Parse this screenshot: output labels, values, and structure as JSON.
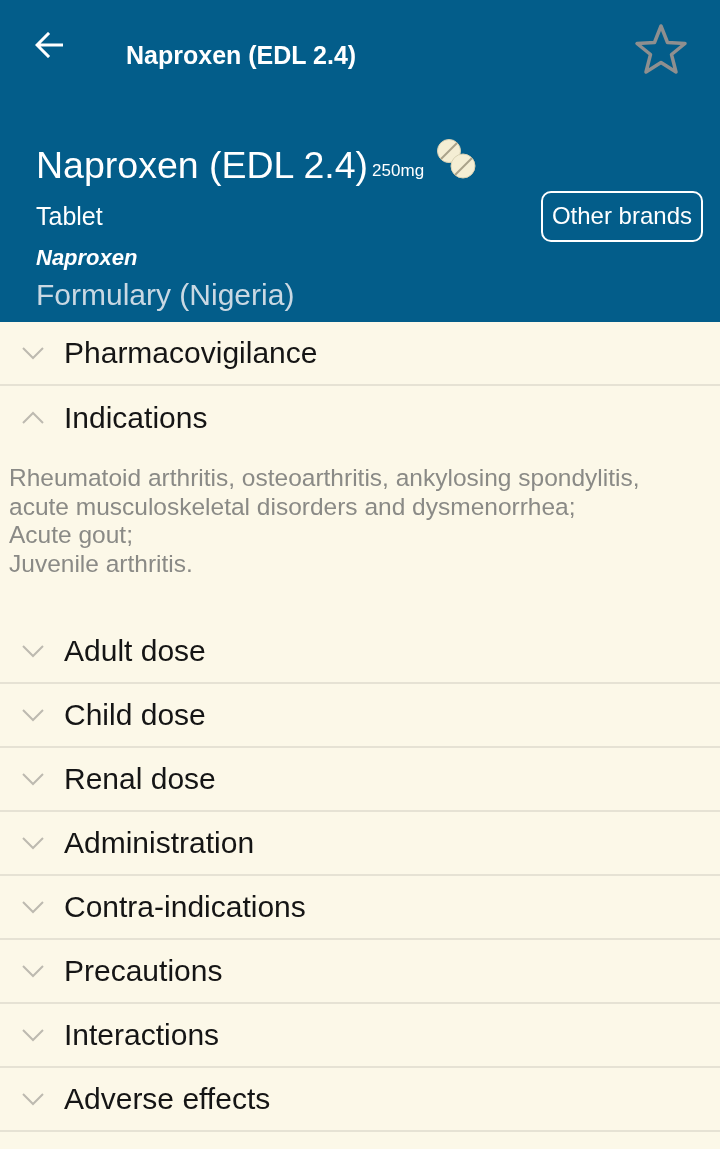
{
  "toolbar": {
    "title": "Naproxen (EDL 2.4)",
    "favorite": false
  },
  "header": {
    "name": "Naproxen (EDL 2.4)",
    "strength": "250mg",
    "form": "Tablet",
    "other_brands_button": "Other brands",
    "generic": "Naproxen",
    "formulary": "Formulary (Nigeria)"
  },
  "sections": [
    {
      "title": "Pharmacovigilance",
      "expanded": false
    },
    {
      "title": "Indications",
      "expanded": true,
      "body": [
        "Rheumatoid arthritis, osteoarthritis, ankylosing spondylitis, acute musculoskeletal disorders and dysmenorrhea;",
        "Acute gout;",
        "Juvenile arthritis."
      ]
    },
    {
      "title": "Adult dose",
      "expanded": false
    },
    {
      "title": "Child dose",
      "expanded": false
    },
    {
      "title": "Renal dose",
      "expanded": false
    },
    {
      "title": "Administration",
      "expanded": false
    },
    {
      "title": "Contra-indications",
      "expanded": false
    },
    {
      "title": "Precautions",
      "expanded": false
    },
    {
      "title": "Interactions",
      "expanded": false
    },
    {
      "title": "Adverse effects",
      "expanded": false
    }
  ]
}
